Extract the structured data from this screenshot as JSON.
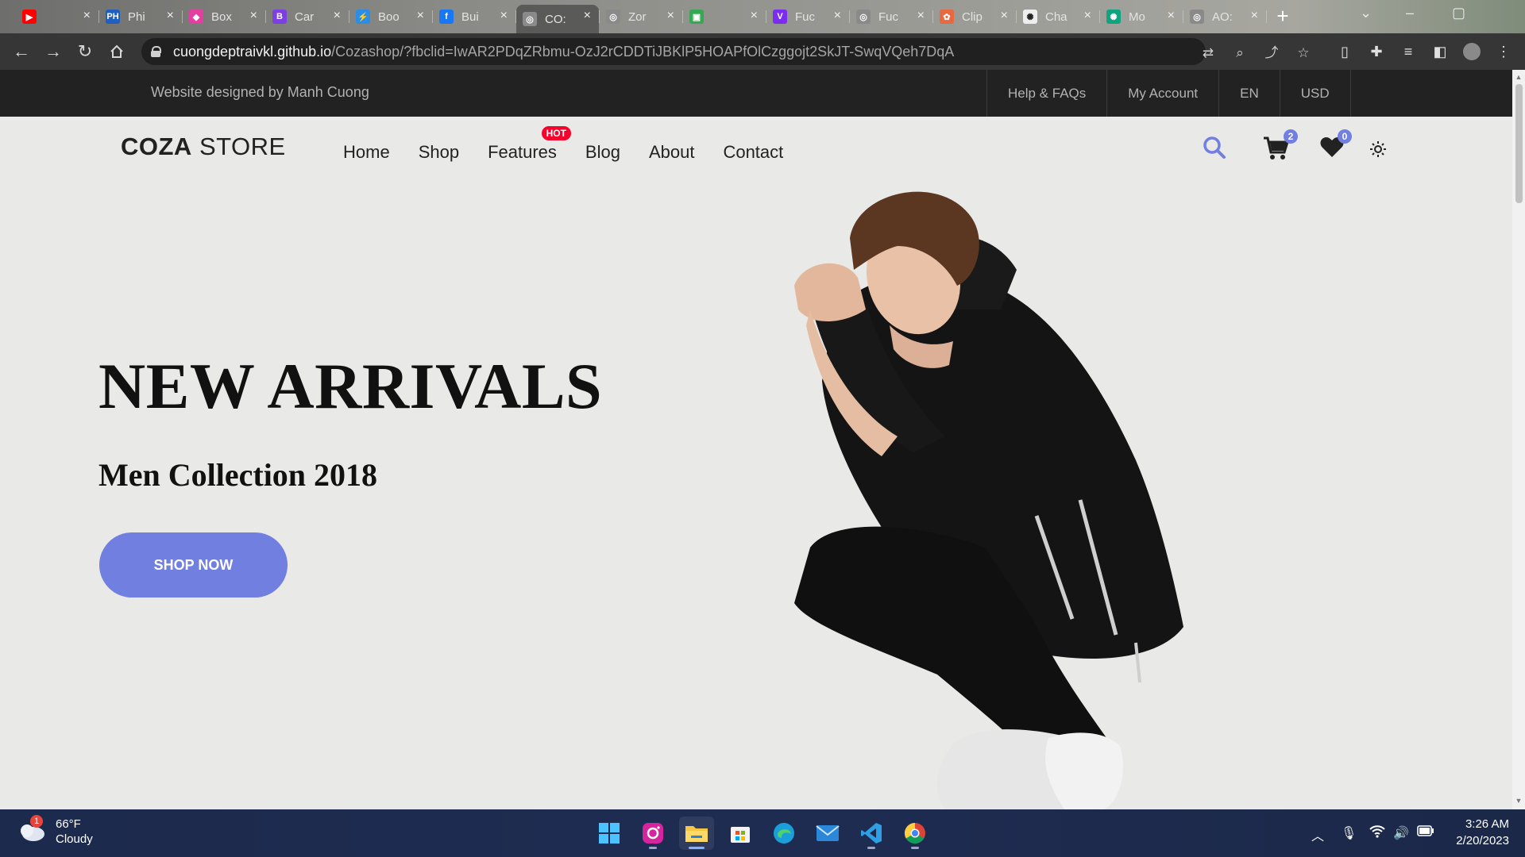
{
  "browser": {
    "tabs": [
      {
        "title": "",
        "favicon": "youtube-icon",
        "color": "#ff0000"
      },
      {
        "title": "Phi",
        "favicon": "ph-icon",
        "color": "#1f5fbf"
      },
      {
        "title": "Box",
        "favicon": "box-icon",
        "color": "#e53ea1"
      },
      {
        "title": "Car",
        "favicon": "b-icon",
        "color": "#7b3fe4"
      },
      {
        "title": "Boo",
        "favicon": "bolt-icon",
        "color": "#2b8ee6"
      },
      {
        "title": "Bui",
        "favicon": "facebook-icon",
        "color": "#1877f2"
      },
      {
        "title": "CO:",
        "favicon": "globe-icon",
        "color": "#8a8a8a"
      },
      {
        "title": "Zor",
        "favicon": "globe-icon",
        "color": "#8a8a8a"
      },
      {
        "title": "",
        "favicon": "meet-icon",
        "color": "#34a853"
      },
      {
        "title": "Fuc",
        "favicon": "v-icon",
        "color": "#7b2cf0"
      },
      {
        "title": "Fuc",
        "favicon": "globe-icon",
        "color": "#8a8a8a"
      },
      {
        "title": "Clip",
        "favicon": "clipchamp-icon",
        "color": "#e8683f"
      },
      {
        "title": "Cha",
        "favicon": "openai-icon",
        "color": "#eeeeee"
      },
      {
        "title": "Mo",
        "favicon": "openai-green-icon",
        "color": "#10a37f"
      },
      {
        "title": "AO:",
        "favicon": "globe-icon",
        "color": "#8a8a8a"
      }
    ],
    "url_host": "cuongdeptraivkl.github.io",
    "url_path": "/Cozashop/?fbclid=IwAR2PDqZRbmu-OzJ2rCDDTiJBKlP5HOAPfOlCzggojt2SkJT-SwqVQeh7DqA"
  },
  "site": {
    "topbar": {
      "designed_by": "Website designed by Manh Cuong",
      "links": [
        "Help & FAQs",
        "My Account",
        "EN",
        "USD"
      ]
    },
    "logo_bold": "COZA",
    "logo_light": " STORE",
    "nav": [
      "Home",
      "Shop",
      "Features",
      "Blog",
      "About",
      "Contact"
    ],
    "hot_label": "HOT",
    "cart_count": "2",
    "wishlist_count": "0",
    "accent_color": "#717fe0",
    "hero": {
      "title": "NEW ARRIVALS",
      "subtitle": "Men Collection 2018",
      "cta": "SHOP NOW"
    }
  },
  "taskbar": {
    "weather_temp": "66°F",
    "weather_desc": "Cloudy",
    "weather_notif": "1",
    "time": "3:26 AM",
    "date": "2/20/2023",
    "apps": [
      "windows-start-icon",
      "instagram-icon",
      "file-explorer-icon",
      "microsoft-store-icon",
      "edge-icon",
      "mail-icon",
      "vscode-icon",
      "chrome-icon"
    ]
  }
}
